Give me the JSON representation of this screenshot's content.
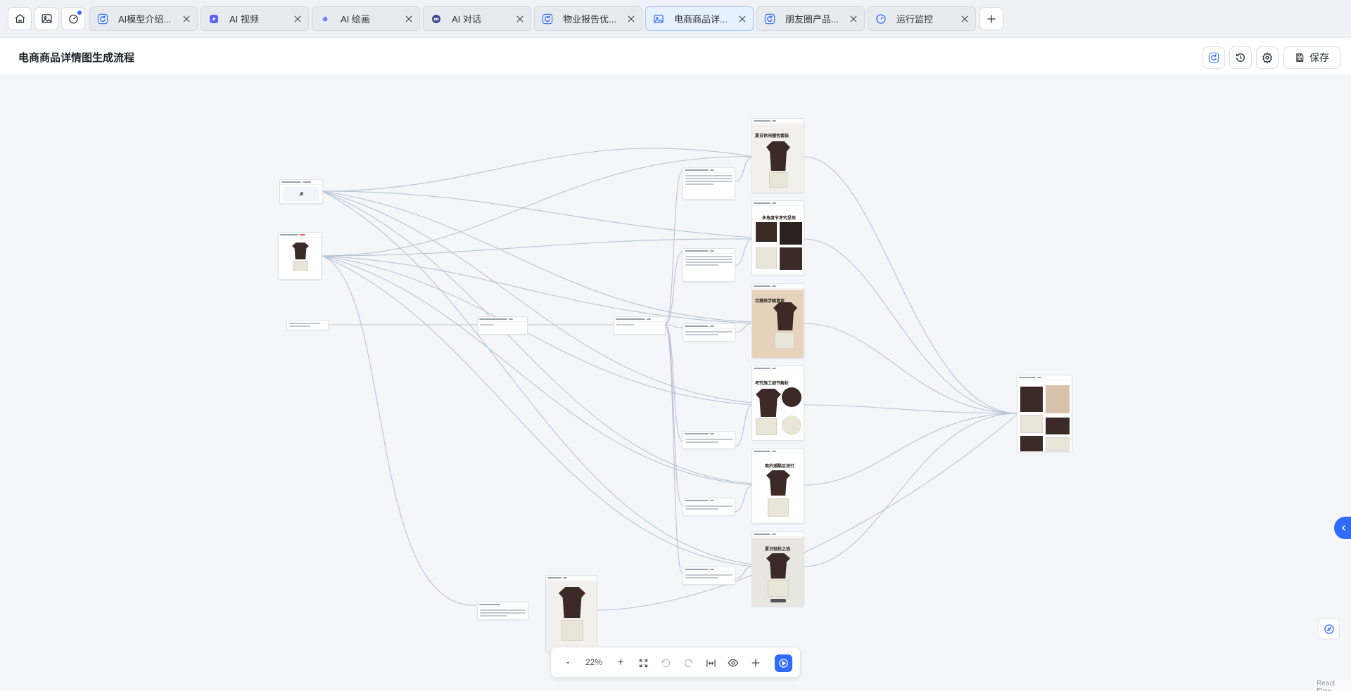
{
  "tabs": [
    {
      "label": "AI模型介绍...",
      "icon": "refresh-icon",
      "active": false
    },
    {
      "label": "AI 视频",
      "icon": "video-icon",
      "active": false
    },
    {
      "label": "AI 绘画",
      "icon": "paint-icon",
      "active": false
    },
    {
      "label": "AI 对话",
      "icon": "chat-bot-icon",
      "active": false
    },
    {
      "label": "物业报告优...",
      "icon": "refresh-icon",
      "active": false
    },
    {
      "label": "电商商品详...",
      "icon": "image-doc-icon",
      "active": true
    },
    {
      "label": "朋友圈产品...",
      "icon": "refresh-icon",
      "active": false
    },
    {
      "label": "运行监控",
      "icon": "gauge-icon",
      "active": false
    }
  ],
  "header": {
    "title": "电商商品详情图生成流程",
    "save_label": "保存"
  },
  "canvas": {
    "posters": [
      {
        "title": "夏日休闲撞色套装"
      },
      {
        "title": "多角度节考究呈现"
      },
      {
        "title": "百搭美学随意穿"
      },
      {
        "title": "考究施工细节解析"
      },
      {
        "title": "简约潮酷至流行"
      },
      {
        "title": "夏日轻松之选"
      }
    ]
  },
  "toolbar": {
    "zoom_out": "-",
    "zoom_level": "22%",
    "zoom_in": "+"
  },
  "colors": {
    "accent": "#2f6bff",
    "edge": "#b8c4d4",
    "shirt": "#3b2a26"
  },
  "attribution": "React Flow"
}
